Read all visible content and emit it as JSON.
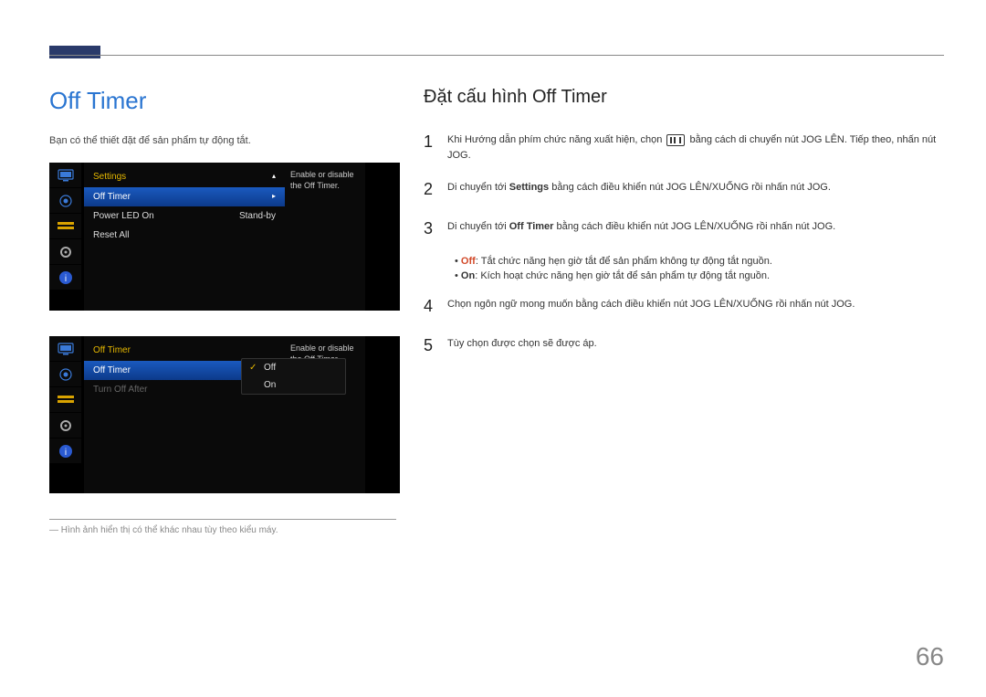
{
  "page": {
    "title_left": "Off Timer",
    "intro": "Bạn có thể thiết đặt để sản phẩm tự động tắt.",
    "title_right": "Đặt cấu hình Off Timer",
    "footnote": "― Hình ảnh hiển thị có thể khác nhau tùy theo kiểu máy.",
    "page_number": "66"
  },
  "osd1": {
    "header": "Settings",
    "rows": [
      {
        "label": "Off Timer",
        "value": "",
        "highlight": true,
        "chev": "▸"
      },
      {
        "label": "Power LED On",
        "value": "Stand-by",
        "highlight": false
      },
      {
        "label": "Reset All",
        "value": "",
        "highlight": false
      }
    ],
    "side": "Enable or disable the Off Timer."
  },
  "osd2": {
    "header": "Off Timer",
    "rows": [
      {
        "label": "Off Timer",
        "value": "",
        "highlight": true
      },
      {
        "label": "Turn Off After",
        "value": "",
        "highlight": false,
        "disabled": true
      }
    ],
    "popup": [
      {
        "label": "Off",
        "checked": true
      },
      {
        "label": "On",
        "checked": false
      }
    ],
    "side": "Enable or disable the Off Timer."
  },
  "steps": {
    "s1_a": "Khi Hướng dẫn phím chức năng xuất hiện, chọn ",
    "s1_b": " bằng cách di chuyển nút JOG LÊN. Tiếp theo, nhấn nút JOG.",
    "s2_a": "Di chuyển tới ",
    "s2_bold": "Settings",
    "s2_b": " bằng cách điều khiển nút JOG LÊN/XUỐNG rồi nhấn nút JOG.",
    "s3_a": "Di chuyển tới ",
    "s3_bold": "Off Timer",
    "s3_b": " bằng cách điều khiển nút JOG LÊN/XUỐNG rồi nhấn nút JOG.",
    "bullet_off_label": "Off",
    "bullet_off_text": ": Tắt chức năng hẹn giờ tắt để sản phẩm không tự động tắt nguồn.",
    "bullet_on_label": "On",
    "bullet_on_text": ": Kích hoạt chức năng hẹn giờ tắt để sản phẩm tự động tắt nguồn.",
    "s4": "Chọn ngôn ngữ mong muốn bằng cách điều khiển nút JOG LÊN/XUỐNG rồi nhấn nút JOG.",
    "s5": "Tùy chọn được chọn sẽ được áp.",
    "n1": "1",
    "n2": "2",
    "n3": "3",
    "n4": "4",
    "n5": "5"
  },
  "tab_icons": [
    "monitor",
    "target",
    "slider",
    "gear",
    "info"
  ]
}
